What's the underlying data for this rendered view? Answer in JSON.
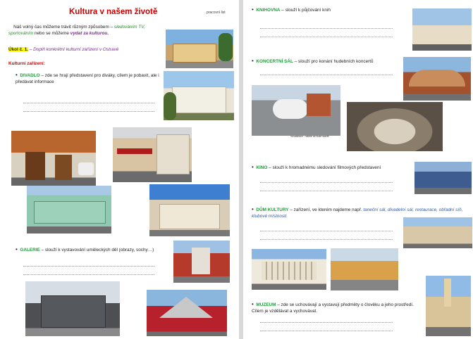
{
  "left": {
    "title": "Kultura v našem životě",
    "label": "pracovní list",
    "intro": {
      "part1": "Náš volný čas můžeme trávit různým způsobem –",
      "em1": "sledováním TV, sportováním",
      "part2": "nebo se můžeme",
      "em2": "vydat za kulturou."
    },
    "task": {
      "label": "Úkol č. 1.",
      "text": "– Doplň konkrétní kulturní zařízení v Ostravě"
    },
    "section_heading": "Kulturní zařízení:",
    "items": [
      {
        "name": "DIVADLO",
        "desc": "– zde se hrají představení pro diváky, cílem je pobavit, ale i předávat informace"
      },
      {
        "name": "GALERIE",
        "desc": "– slouží k vystavování uměleckých děl (obrazy, sochy…)"
      }
    ]
  },
  "right": {
    "items": [
      {
        "name": "KNIHOVNA",
        "desc": "– slouží k půjčování knih"
      },
      {
        "name": "KONCERTNÍ SÁL",
        "desc": "– slouží pro konání hudebních koncertů"
      },
      {
        "name": "KINO",
        "desc": "– slouží k hromadnému sledování filmových představení"
      },
      {
        "name": "DŮM KULTURY",
        "desc": "– zařízení, ve kterém najdeme např.",
        "em": "taneční sál, divadelní sál, restaurace, obřadní síň, klubové místnosti"
      },
      {
        "name": "MUZEUM",
        "desc": "– zde se uchovávají a vystavují předměty o člověku a jeho prostředí. Cílem je vzdělávat a vychovávat."
      }
    ],
    "caption": "Vizualizace – takhle se bude stavět"
  }
}
